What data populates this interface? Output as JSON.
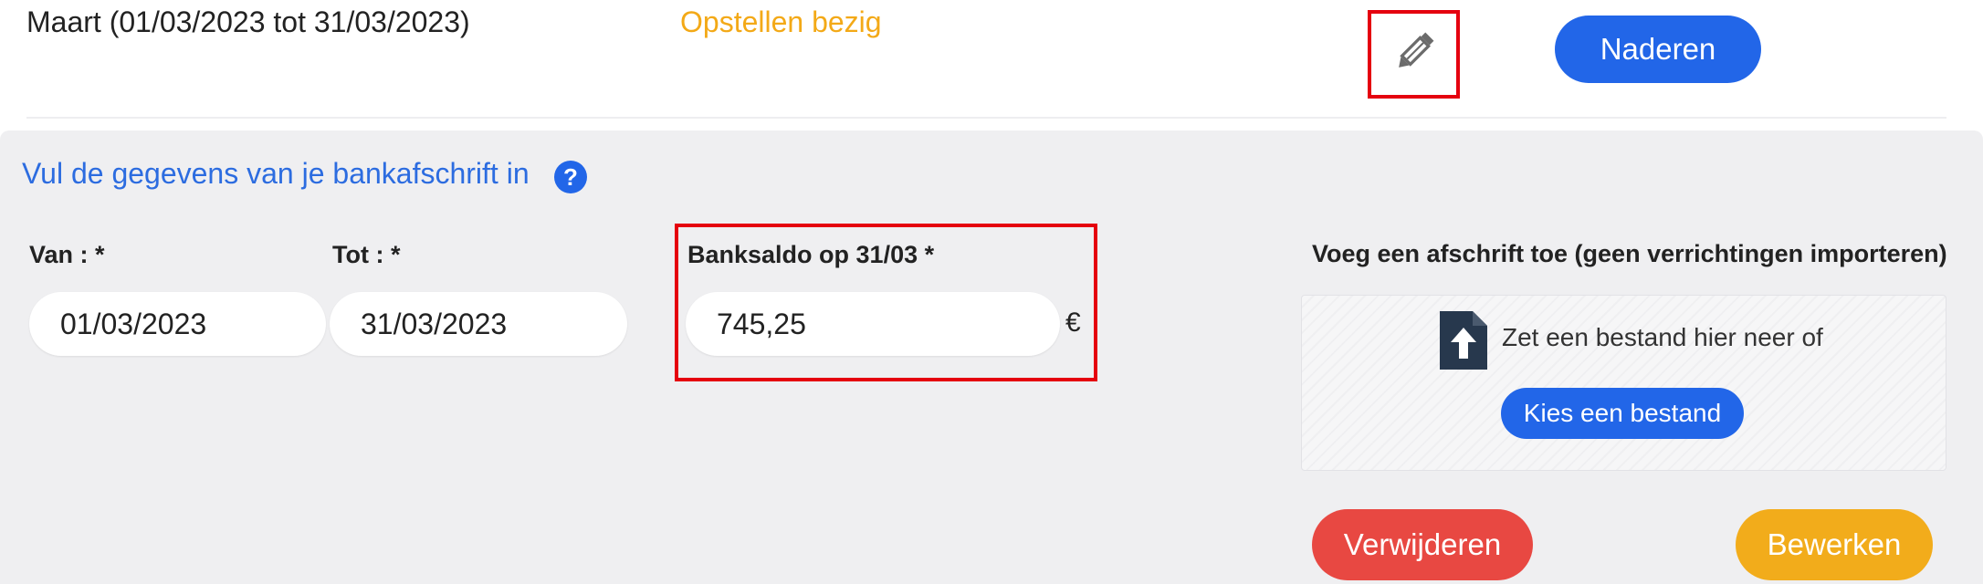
{
  "header": {
    "period_label": "Maart (01/03/2023 tot 31/03/2023)",
    "status_label": "Opstellen bezig",
    "edit_icon": "pencil-icon",
    "approach_button": "Naderen"
  },
  "form": {
    "title": "Vul de gegevens van je bankafschrift in",
    "help_icon": "?",
    "from_label": "Van : *",
    "from_value": "01/03/2023",
    "to_label": "Tot : *",
    "to_value": "31/03/2023",
    "balance_label": "Banksaldo op 31/03 *",
    "balance_value": "745,25",
    "currency": "€"
  },
  "upload": {
    "title": "Voeg een afschrift toe (geen verrichtingen importeren)",
    "file_icon": "file-upload-icon",
    "drop_text": "Zet een bestand hier neer of",
    "choose_button": "Kies een bestand"
  },
  "actions": {
    "delete_button": "Verwijderen",
    "edit_button": "Bewerken"
  },
  "colors": {
    "primary": "#2266e8",
    "status": "#f3a917",
    "danger": "#e84842",
    "warning": "#f2ac1b",
    "highlight": "#e5000f"
  }
}
